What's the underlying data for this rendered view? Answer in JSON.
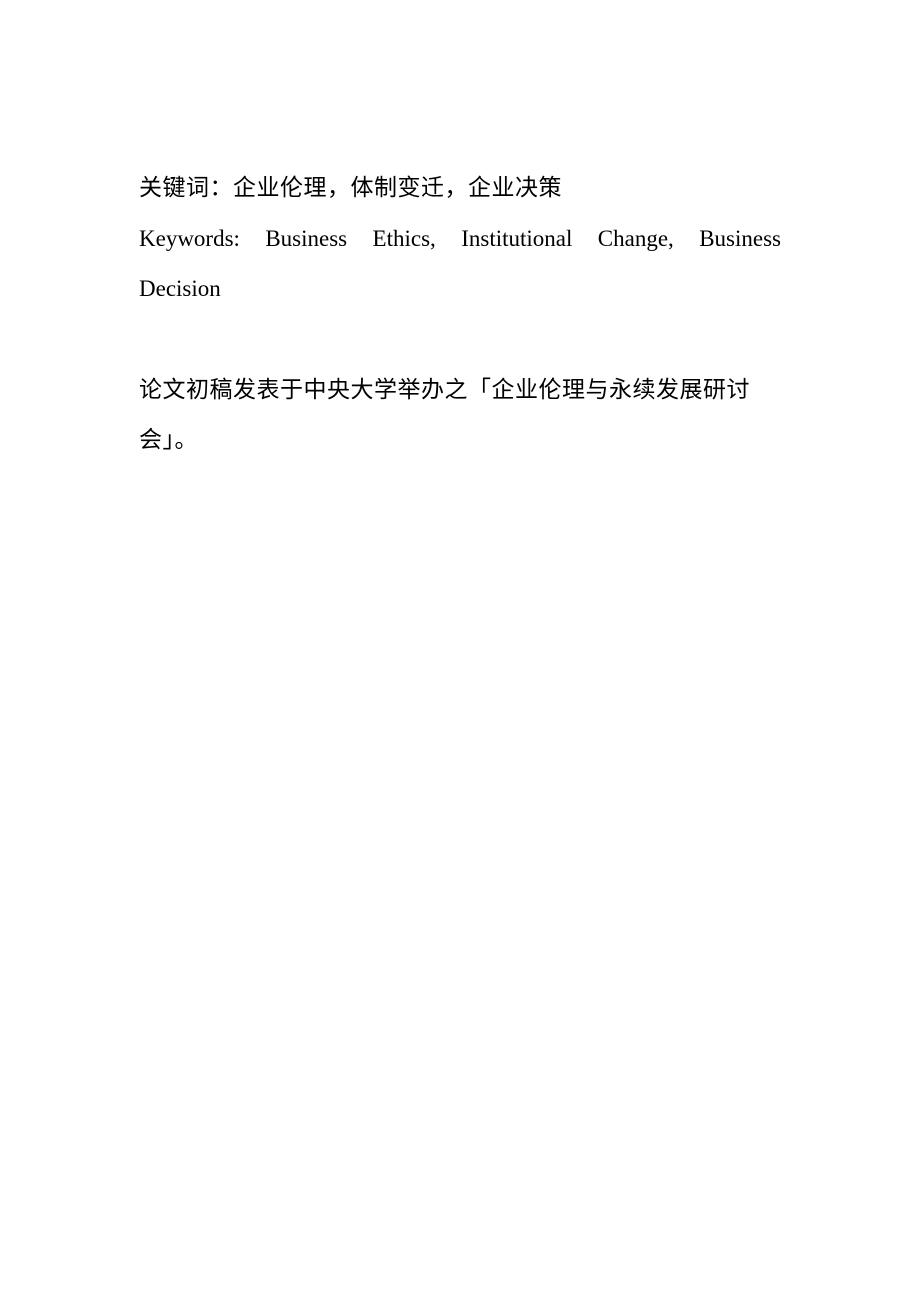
{
  "keywords_cn": {
    "label": "关键词：",
    "text": "企业伦理，体制变迁，企业决策"
  },
  "keywords_en": {
    "label": "Keywords:",
    "words_line1": [
      "Keywords:",
      "Business",
      "Ethics,",
      "Institutional",
      "Change,",
      "Business"
    ],
    "line2": "Decision"
  },
  "note": {
    "line1": "论文初稿发表于中央大学举办之「企业伦理与永续发展研讨",
    "line2": "会」。"
  }
}
